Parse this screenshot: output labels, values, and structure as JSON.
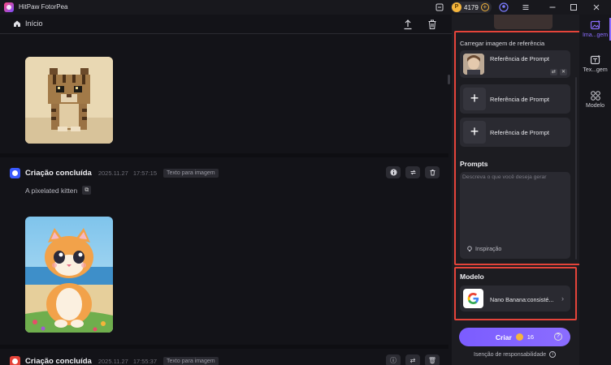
{
  "app": {
    "title": "HitPaw FotorPea",
    "credits": "4179"
  },
  "main": {
    "nav": {
      "home_label": "Início"
    }
  },
  "feed": {
    "items": [
      {
        "title": "Criação concluída",
        "date": "2025.11.27",
        "time": "17:57:15",
        "tag": "Texto para imagem",
        "prompt": "A pixelated kitten"
      },
      {
        "title": "Criação concluída",
        "date": "2025.11.27",
        "time": "17:55:37",
        "tag": "Texto para imagem"
      }
    ]
  },
  "panel": {
    "ref_section_label": "Carregar imagem de referência",
    "references": [
      {
        "label": "Referência de Prompt",
        "filled": true
      },
      {
        "label": "Referência de Prompt",
        "filled": false
      },
      {
        "label": "Referência de Prompt",
        "filled": false
      }
    ],
    "prompts_heading": "Prompts",
    "prompt_placeholder": "Descreva o que você deseja gerar",
    "inspiration_label": "Inspiração",
    "model_heading": "Modelo",
    "model_name": "Nano Banana:consisté...",
    "create_label": "Criar",
    "create_cost": "16",
    "disclaimer": "Isenção de responsabilidade"
  },
  "rail": {
    "items": [
      {
        "label": "Ima...gem",
        "icon": "image-add-icon",
        "active": true
      },
      {
        "label": "Tex...gem",
        "icon": "text-image-icon",
        "active": false
      },
      {
        "label": "Modelo",
        "icon": "model-grid-icon",
        "active": false
      }
    ]
  },
  "colors": {
    "accent": "#8b6dff",
    "highlight_outline": "#e5443a",
    "coin": "#f5b53c"
  }
}
